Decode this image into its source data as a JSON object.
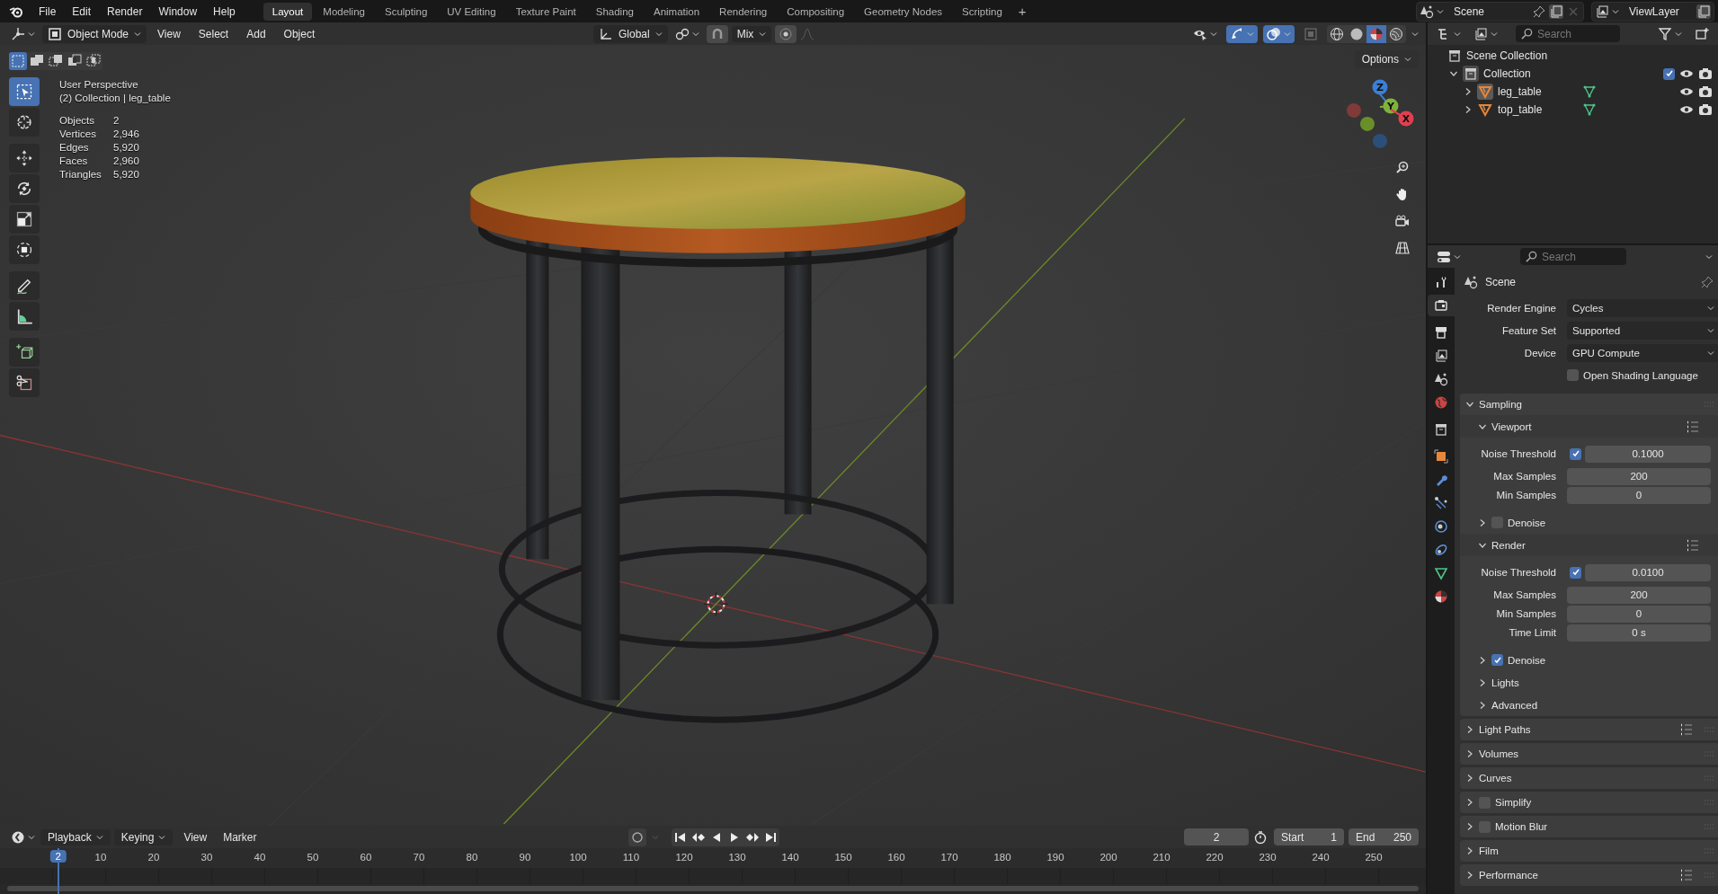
{
  "menu": [
    "File",
    "Edit",
    "Render",
    "Window",
    "Help"
  ],
  "workspaces": [
    {
      "label": "Layout",
      "selected": true
    },
    {
      "label": "Modeling",
      "selected": false
    },
    {
      "label": "Sculpting",
      "selected": false
    },
    {
      "label": "UV Editing",
      "selected": false
    },
    {
      "label": "Texture Paint",
      "selected": false
    },
    {
      "label": "Shading",
      "selected": false
    },
    {
      "label": "Animation",
      "selected": false
    },
    {
      "label": "Rendering",
      "selected": false
    },
    {
      "label": "Compositing",
      "selected": false
    },
    {
      "label": "Geometry Nodes",
      "selected": false
    },
    {
      "label": "Scripting",
      "selected": false
    }
  ],
  "add_workspace": "+",
  "scene": {
    "value": "Scene"
  },
  "view_layer": {
    "value": "ViewLayer"
  },
  "viewport": {
    "mode": "Object Mode",
    "menus": [
      "View",
      "Select",
      "Add",
      "Object"
    ],
    "orientation": "Global",
    "snap_target": "Mix",
    "toggles": [
      {
        "kind": "visibility",
        "on": false
      },
      {
        "kind": "gizmo",
        "on": true
      },
      {
        "kind": "overlay",
        "on": true
      },
      {
        "kind": "xray",
        "on": false
      }
    ],
    "shading": [
      {
        "kind": "wireframe",
        "selected": false
      },
      {
        "kind": "solid",
        "selected": false
      },
      {
        "kind": "material",
        "selected": true
      },
      {
        "kind": "rendered",
        "selected": false
      }
    ],
    "options": "Options",
    "select_modes": [
      {
        "kind": "set",
        "selected": true
      },
      {
        "kind": "extend",
        "selected": false
      },
      {
        "kind": "subtract",
        "selected": false
      },
      {
        "kind": "difference",
        "selected": false
      },
      {
        "kind": "intersect",
        "selected": false
      }
    ],
    "tools": [
      {
        "kind": "select",
        "selected": true
      },
      {
        "kind": "cursor",
        "selected": false
      },
      {
        "kind": "move",
        "selected": false
      },
      {
        "kind": "rotate",
        "selected": false
      },
      {
        "kind": "scale",
        "selected": false
      },
      {
        "kind": "transform",
        "selected": false
      },
      {
        "kind": "annotate",
        "selected": false
      },
      {
        "kind": "measure",
        "selected": false
      },
      {
        "kind": "add_cube",
        "selected": false
      },
      {
        "kind": "cut",
        "selected": false
      }
    ],
    "info": {
      "view": "User Perspective",
      "context": "(2) Collection | leg_table",
      "stats": [
        {
          "label": "Objects",
          "value": "2"
        },
        {
          "label": "Vertices",
          "value": "2,946"
        },
        {
          "label": "Edges",
          "value": "5,920"
        },
        {
          "label": "Faces",
          "value": "2,960"
        },
        {
          "label": "Triangles",
          "value": "5,920"
        }
      ]
    },
    "gizmo_axes": [
      "Z",
      "Y",
      "X"
    ]
  },
  "outliner": {
    "search": {
      "placeholder": "Search"
    },
    "tree": [
      {
        "label": "Scene Collection",
        "children": [
          {
            "label": "Collection",
            "expanded": true,
            "checked": true,
            "children": [
              {
                "label": "leg_table",
                "expanded": false,
                "active": true
              },
              {
                "label": "top_table",
                "expanded": false,
                "active": false
              }
            ]
          }
        ]
      }
    ]
  },
  "properties": {
    "search": {
      "placeholder": "Search"
    },
    "tabs": [
      {
        "kind": "tool",
        "selected": false
      },
      {
        "kind": "render",
        "selected": true
      },
      {
        "kind": "output",
        "selected": false
      },
      {
        "kind": "view_layer",
        "selected": false
      },
      {
        "kind": "scene",
        "selected": false
      },
      {
        "kind": "world",
        "selected": false
      },
      {
        "kind": "collection",
        "selected": false
      },
      {
        "kind": "object",
        "selected": false
      },
      {
        "kind": "modifier",
        "selected": false
      },
      {
        "kind": "particles",
        "selected": false
      },
      {
        "kind": "physics",
        "selected": false
      },
      {
        "kind": "constraints",
        "selected": false
      },
      {
        "kind": "data",
        "selected": false
      },
      {
        "kind": "material",
        "selected": false
      }
    ],
    "context": "Scene",
    "fields": [
      {
        "label": "Render Engine",
        "value": "Cycles"
      },
      {
        "label": "Feature Set",
        "value": "Supported"
      },
      {
        "label": "Device",
        "value": "GPU Compute"
      }
    ],
    "osl": {
      "label": "Open Shading Language",
      "checked": false
    },
    "panels": [
      {
        "label": "Sampling",
        "expanded": true,
        "children": [
          {
            "label": "Viewport",
            "expanded": true,
            "presets": true,
            "rows": [
              {
                "kind": "toggle_number",
                "label": "Noise Threshold",
                "checked": true,
                "value": "0.1000"
              },
              {
                "kind": "number",
                "label": "Max Samples",
                "value": "200"
              },
              {
                "kind": "number",
                "label": "Min Samples",
                "value": "0"
              }
            ]
          },
          {
            "label": "Denoise",
            "expanded": false,
            "checked": false
          },
          {
            "label": "Render",
            "expanded": true,
            "presets": true,
            "rows": [
              {
                "kind": "toggle_number",
                "label": "Noise Threshold",
                "checked": true,
                "value": "0.0100"
              },
              {
                "kind": "number",
                "label": "Max Samples",
                "value": "200"
              },
              {
                "kind": "number",
                "label": "Min Samples",
                "value": "0"
              },
              {
                "kind": "number",
                "label": "Time Limit",
                "value": "0 s"
              }
            ]
          },
          {
            "label": "Denoise",
            "expanded": false,
            "checked": true
          },
          {
            "label": "Lights",
            "expanded": false
          },
          {
            "label": "Advanced",
            "expanded": false
          }
        ]
      },
      {
        "label": "Light Paths",
        "expanded": false,
        "presets": true
      },
      {
        "label": "Volumes",
        "expanded": false
      },
      {
        "label": "Curves",
        "expanded": false
      },
      {
        "label": "Simplify",
        "expanded": false,
        "checked": false
      },
      {
        "label": "Motion Blur",
        "expanded": false,
        "checked": false
      },
      {
        "label": "Film",
        "expanded": false
      },
      {
        "label": "Performance",
        "expanded": false,
        "presets": true
      }
    ]
  },
  "timeline": {
    "menus": [
      {
        "label": "Playback",
        "dropdown": true
      },
      {
        "label": "Keying",
        "dropdown": true
      },
      {
        "label": "View",
        "dropdown": false
      },
      {
        "label": "Marker",
        "dropdown": false
      }
    ],
    "current_frame": "2",
    "start": {
      "label": "Start",
      "value": "1"
    },
    "end": {
      "label": "End",
      "value": "250"
    },
    "ruler": [
      "10",
      "20",
      "30",
      "40",
      "50",
      "60",
      "70",
      "80",
      "90",
      "100",
      "110",
      "120",
      "130",
      "140",
      "150",
      "160",
      "170",
      "180",
      "190",
      "200",
      "210",
      "220",
      "230",
      "240",
      "250"
    ],
    "playhead": "2"
  }
}
